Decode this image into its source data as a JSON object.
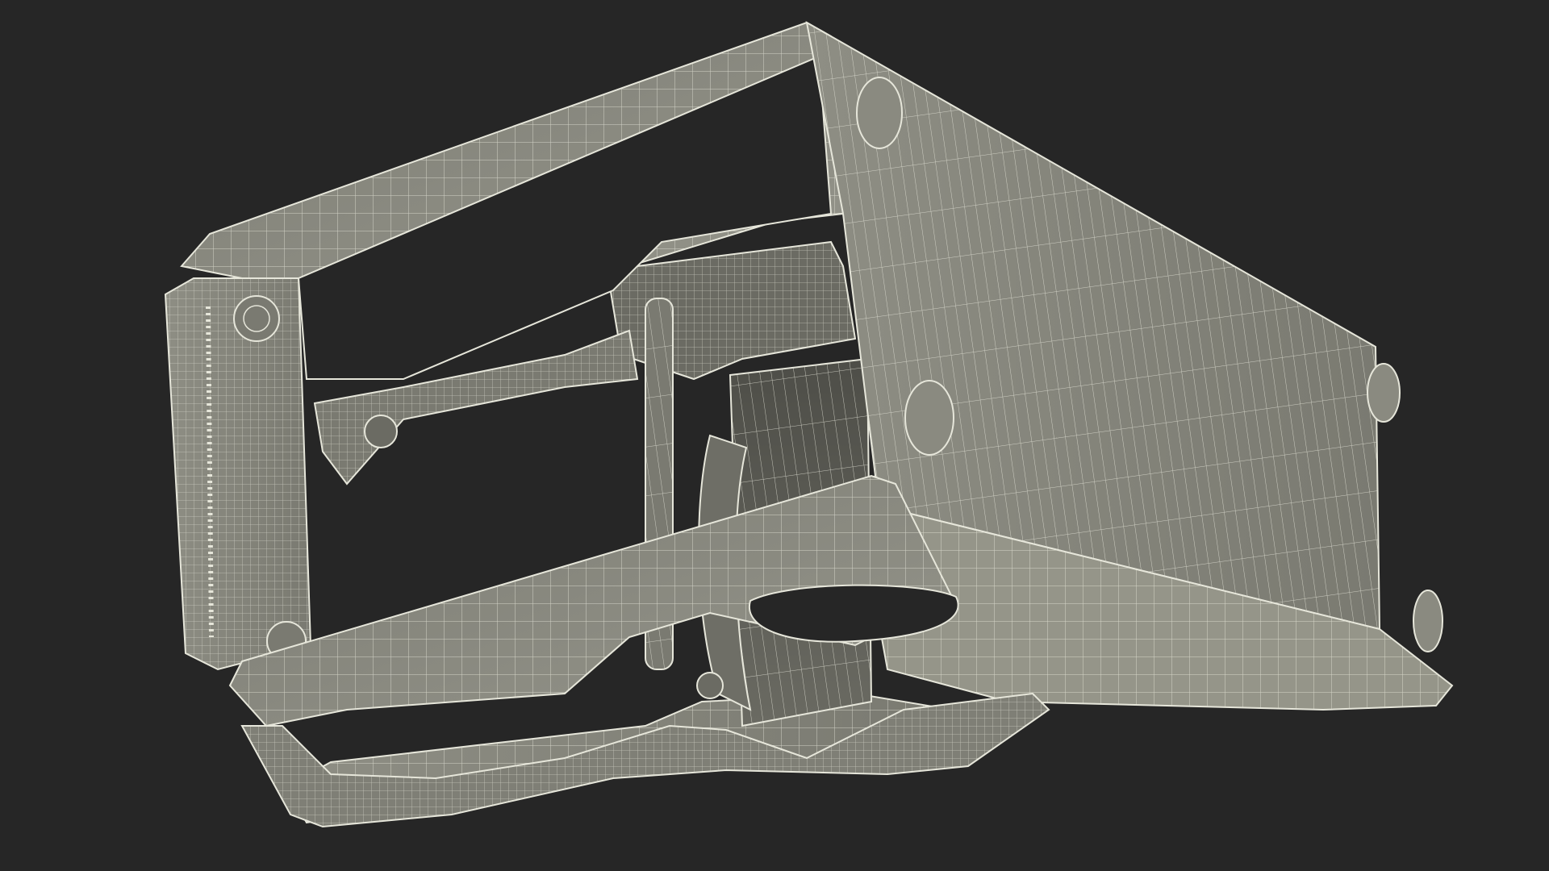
{
  "scene": {
    "background_color": "#262626",
    "surface_color": "#8b8b81",
    "surface_light": "#a3a398",
    "surface_dark": "#5f5f57",
    "wire_color": "#e8e8dc",
    "subject": "wireframe-3d-model"
  }
}
